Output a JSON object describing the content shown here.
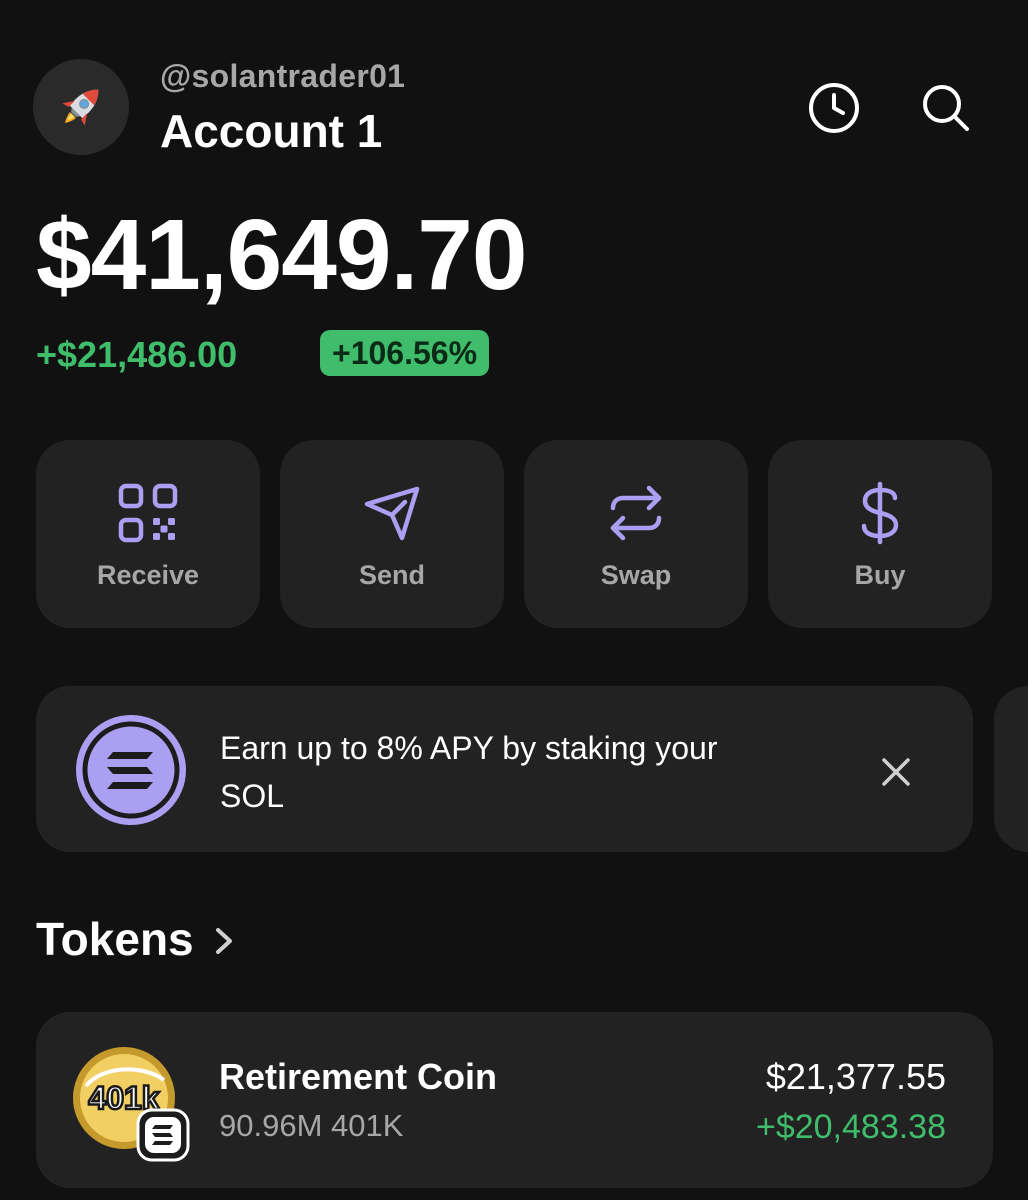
{
  "header": {
    "username": "@solantrader01",
    "account_name": "Account 1",
    "avatar_icon": "rocket-icon",
    "icons": [
      "history-icon",
      "search-icon"
    ]
  },
  "balance": {
    "total": "$41,649.70",
    "change_amount": "+$21,486.00",
    "change_percent": "+106.56%"
  },
  "actions": [
    {
      "label": "Receive",
      "icon": "qr-code-icon"
    },
    {
      "label": "Send",
      "icon": "send-icon"
    },
    {
      "label": "Swap",
      "icon": "swap-icon"
    },
    {
      "label": "Buy",
      "icon": "dollar-icon"
    }
  ],
  "promo": {
    "text": "Earn up to 8% APY by staking your SOL",
    "icon": "solana-icon"
  },
  "tokens": {
    "title": "Tokens",
    "items": [
      {
        "logo_text": "401k",
        "name": "Retirement Coin",
        "quantity": "90.96M 401K",
        "value": "$21,377.55",
        "change": "+$20,483.38"
      }
    ]
  },
  "colors": {
    "background": "#111111",
    "card": "#222222",
    "accent": "#ab9ff2",
    "positive": "#3fbd6b",
    "secondary_text": "#a7a7a7"
  }
}
